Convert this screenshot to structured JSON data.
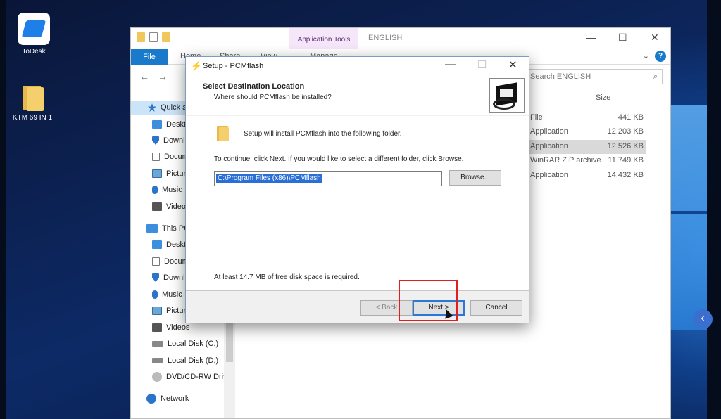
{
  "desktop": {
    "icons": [
      {
        "label": "ToDesk"
      },
      {
        "label": "KTM 69 IN 1"
      }
    ]
  },
  "explorer": {
    "contextual_tab": "Application Tools",
    "title": "ENGLISH",
    "ribbon_tabs": {
      "file": "File",
      "home": "Home",
      "share": "Share",
      "view": "View",
      "manage": "Manage"
    },
    "search_placeholder": "Search ENGLISH",
    "column_size": "Size",
    "nav": [
      {
        "label": "Quick access"
      },
      {
        "label": "Desktop"
      },
      {
        "label": "Downloads"
      },
      {
        "label": "Documents"
      },
      {
        "label": "Pictures"
      },
      {
        "label": "Music"
      },
      {
        "label": "Videos"
      },
      {
        "label": "This PC"
      },
      {
        "label": "Desktop"
      },
      {
        "label": "Documents"
      },
      {
        "label": "Downloads"
      },
      {
        "label": "Music"
      },
      {
        "label": "Pictures"
      },
      {
        "label": "Videos"
      },
      {
        "label": "Local Disk (C:)"
      },
      {
        "label": "Local Disk (D:)"
      },
      {
        "label": "DVD/CD-RW Drive"
      },
      {
        "label": "Network"
      }
    ],
    "files": [
      {
        "type": "File",
        "size": "441 KB"
      },
      {
        "type": "Application",
        "size": "12,203 KB"
      },
      {
        "type": "Application",
        "size": "12,526 KB"
      },
      {
        "type": "WinRAR ZIP archive",
        "size": "11,749 KB"
      },
      {
        "type": "Application",
        "size": "14,432 KB"
      }
    ]
  },
  "dialog": {
    "title": "Setup - PCMflash",
    "heading": "Select Destination Location",
    "subheading": "Where should PCMflash be installed?",
    "info_line": "Setup will install PCMflash into the following folder.",
    "instruction": "To continue, click Next. If you would like to select a different folder, click Browse.",
    "path_value": "C:\\Program Files (x86)\\PCMflash",
    "browse_label": "Browse...",
    "disk_requirement": "At least 14.7 MB of free disk space is required.",
    "back_label": "< Back",
    "next_label": "Next >",
    "cancel_label": "Cancel"
  },
  "colors": {
    "highlight": "#e02020",
    "selection": "#2a6fd6",
    "file_tab": "#1979ca"
  }
}
